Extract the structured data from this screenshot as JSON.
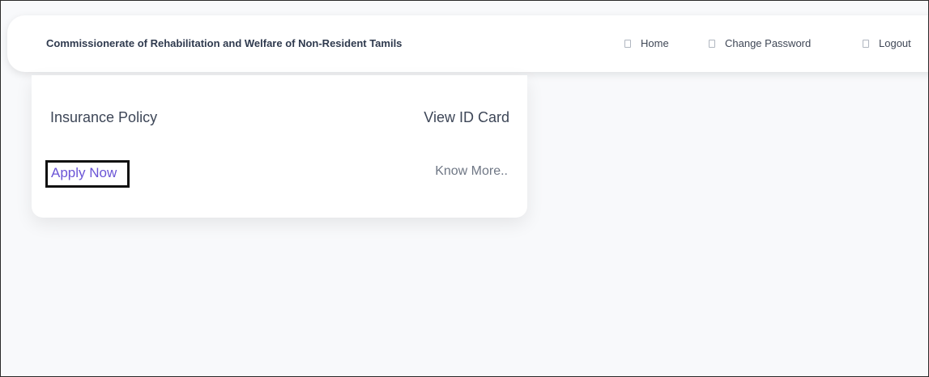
{
  "header": {
    "brand": "Commissionerate of Rehabilitation and Welfare of Non-Resident Tamils",
    "nav": [
      {
        "label": "Home",
        "icon": "page-icon"
      },
      {
        "label": "Change Password",
        "icon": "key-icon"
      },
      {
        "label": "Logout",
        "icon": "logout-icon"
      }
    ]
  },
  "card": {
    "title": "Insurance Policy",
    "view_id_card": "View ID Card",
    "apply_now": "Apply Now",
    "know_more": "Know More.."
  },
  "colors": {
    "background": "#f8f9fb",
    "card_background": "#ffffff",
    "link_purple": "#6b55d6",
    "text": "#3d4657"
  }
}
